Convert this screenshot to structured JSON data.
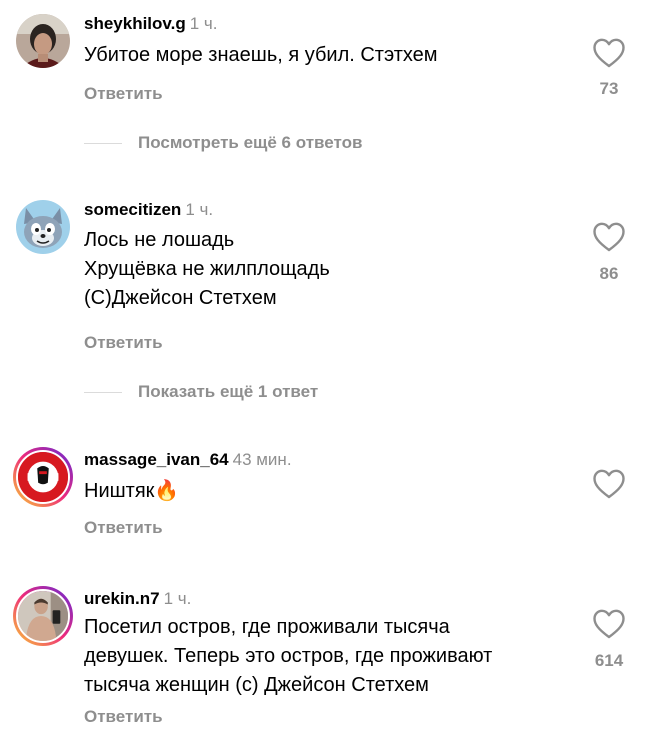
{
  "comments": [
    {
      "username": "sheykhilov.g",
      "time": "1 ч.",
      "lines": [
        "Убитое море знаешь, я убил. Стэтхем"
      ],
      "reply_label": "Ответить",
      "likes": "73",
      "avatar_icon": "dark-haired-person-avatar"
    },
    {
      "username": "somecitizen",
      "time": "1 ч.",
      "lines": [
        "Лось не лошадь",
        "Хрущёвка не жилплощадь",
        "(С)Джейсон Стетхем"
      ],
      "reply_label": "Ответить",
      "likes": "86",
      "avatar_icon": "cartoon-cat-avatar"
    },
    {
      "username": "massage_ivan_64",
      "time": "43 мин.",
      "lines": [
        "Ништяк"
      ],
      "emoji": "🔥",
      "reply_label": "Ответить",
      "likes": "",
      "avatar_icon": "spartak-logo-avatar"
    },
    {
      "username": "urekin.n7",
      "time": "1 ч.",
      "lines": [
        "Посетил остров, где проживали тысяча",
        "девушек. Теперь это остров, где проживают",
        "тысяча женщин (с) Джейсон Стетхем"
      ],
      "reply_label": "Ответить",
      "likes": "614",
      "avatar_icon": "mirror-selfie-avatar"
    }
  ],
  "view_more_replies_1": "Посмотреть ещё 6 ответов",
  "view_more_replies_2": "Показать ещё 1 ответ",
  "colors": {
    "secondary_text": "#8e8e8e",
    "story_ring_start": "#f9ce34",
    "story_ring_mid": "#ee2a7b",
    "story_ring_end": "#6228d7",
    "spartak_red": "#d71920"
  }
}
